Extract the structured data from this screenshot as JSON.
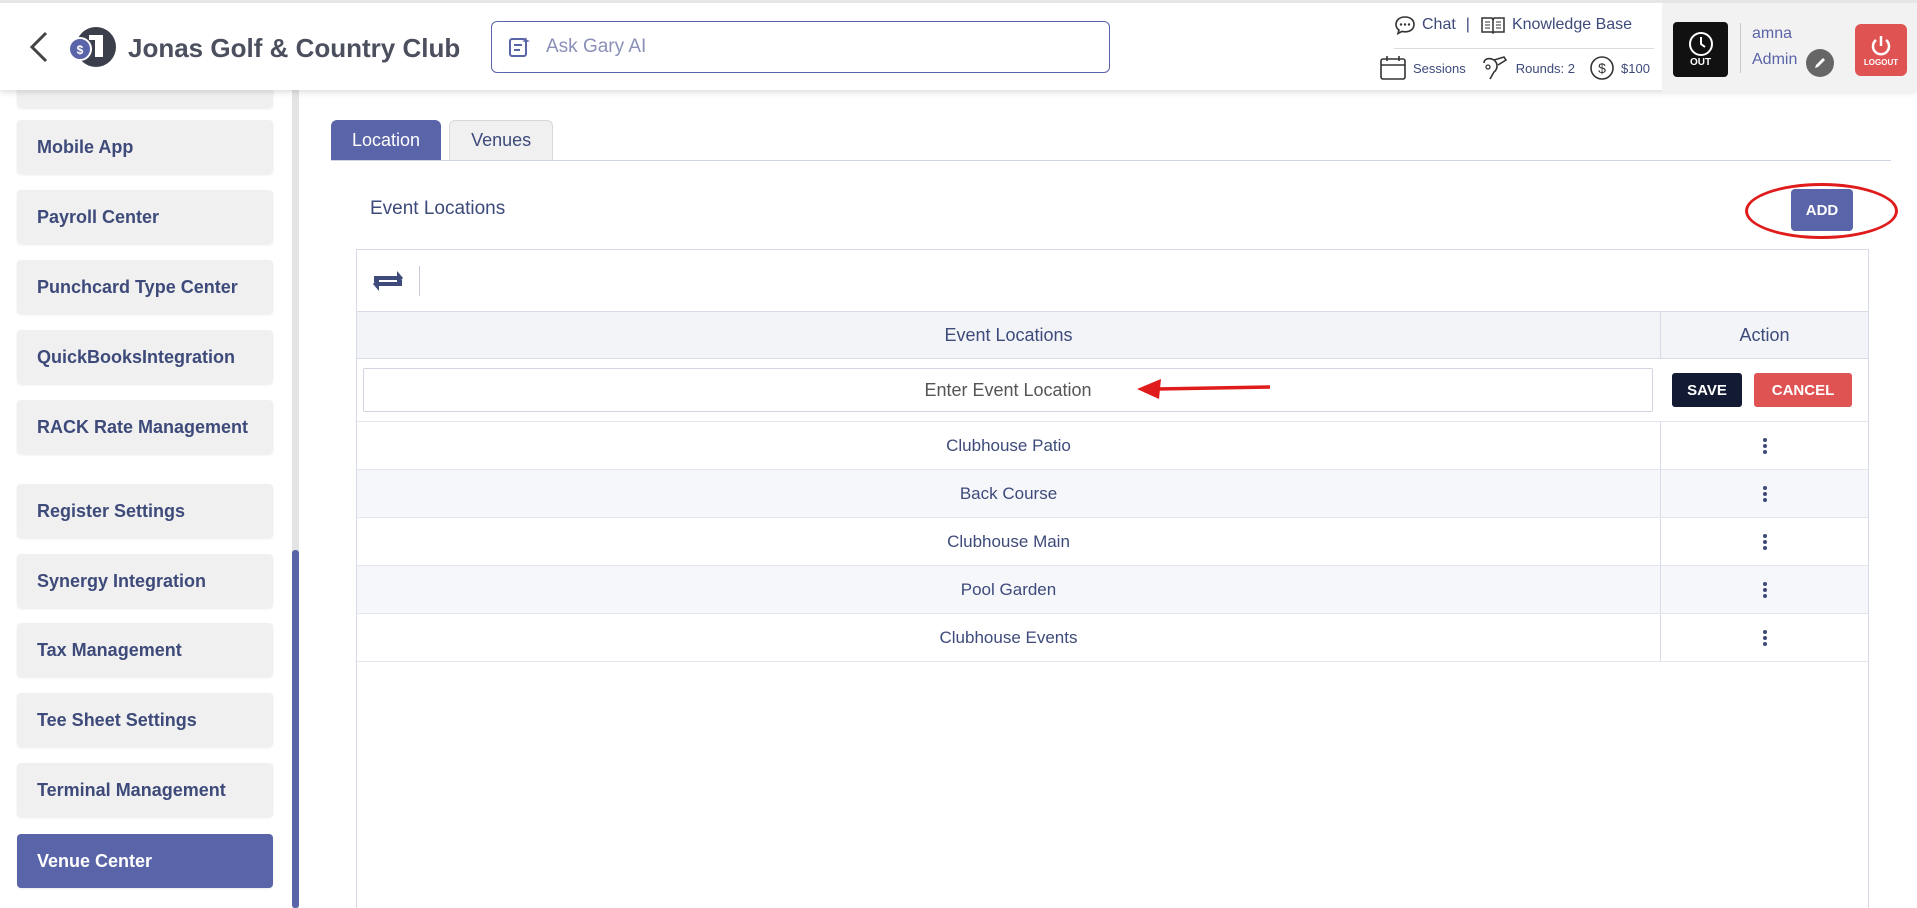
{
  "header": {
    "club_name": "Jonas Golf & Country Club",
    "ask_placeholder": "Ask Gary AI",
    "chat_label": "Chat",
    "separator": "|",
    "knowledge_label": "Knowledge Base",
    "sessions_label": "Sessions",
    "rounds_label": "Rounds: 2",
    "balance_label": "$100",
    "out_label": "OUT",
    "user_name": "amna",
    "user_role": "Admin",
    "logout_label": "LOGOUT"
  },
  "sidebar": {
    "items": [
      {
        "label": "Mobile App",
        "top": 0
      },
      {
        "label": "Payroll Center"
      },
      {
        "label": "Punchcard Type Center"
      },
      {
        "label": "QuickBooksIntegration"
      },
      {
        "label": "RACK Rate Management"
      },
      {
        "label": "Register Settings"
      },
      {
        "label": "Synergy Integration"
      },
      {
        "label": "Tax Management"
      },
      {
        "label": "Tee Sheet Settings"
      },
      {
        "label": "Terminal Management"
      },
      {
        "label": "Venue Center",
        "active": true
      }
    ]
  },
  "tabs": {
    "location": "Location",
    "venues": "Venues"
  },
  "main": {
    "section_title": "Event Locations",
    "add_label": "ADD",
    "col_locations": "Event Locations",
    "col_action": "Action",
    "input_placeholder": "Enter Event Location",
    "save_label": "SAVE",
    "cancel_label": "CANCEL",
    "rows": [
      "Clubhouse Patio",
      "Back Course",
      "Clubhouse Main",
      "Pool Garden",
      "Clubhouse Events"
    ]
  },
  "colors": {
    "accent": "#5a64a8",
    "danger": "#e05353",
    "annotation": "#e01b1b"
  }
}
